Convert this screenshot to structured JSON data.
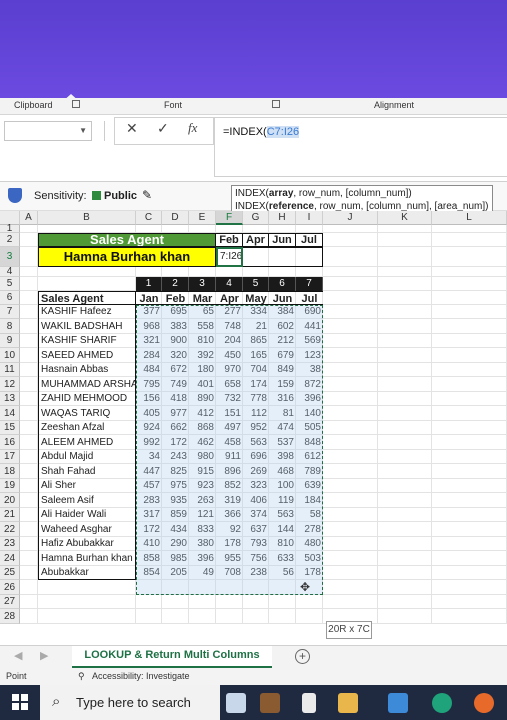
{
  "ribbon": {
    "clipboard": "Clipboard",
    "font": "Font",
    "alignment": "Alignment"
  },
  "formula_bar": {
    "name_box": "",
    "cancel": "✕",
    "enter": "✓",
    "fx": "fx",
    "formula_prefix": "=INDEX(",
    "formula_ref": "C7:I26"
  },
  "sensitivity": {
    "label": "Sensitivity:",
    "value": "Public",
    "badge_color": "#2e8b3d"
  },
  "tooltip": {
    "line1_pre": "INDEX(",
    "line1_bold": "array",
    "line1_post": ", row_num, [column_num])",
    "line2_pre": "INDEX(",
    "line2_bold": "reference",
    "line2_post": ", row_num, [column_num], [area_num])"
  },
  "columns": [
    "A",
    "B",
    "C",
    "D",
    "E",
    "F",
    "G",
    "H",
    "I",
    "J",
    "K",
    "L"
  ],
  "rows": [
    "1",
    "2",
    "3",
    "4",
    "5",
    "6",
    "7",
    "8",
    "9",
    "10",
    "11",
    "12",
    "13",
    "14",
    "15",
    "16",
    "17",
    "18",
    "19",
    "20",
    "21",
    "22",
    "23",
    "24",
    "25",
    "26",
    "27",
    "28"
  ],
  "top_table": {
    "header": "Sales Agent",
    "months": [
      "Feb",
      "Apr",
      "Jun",
      "Jul"
    ],
    "agent": "Hamna Burhan khan",
    "cell_f3": "7:I26"
  },
  "index_row": [
    "1",
    "2",
    "3",
    "4",
    "5",
    "6",
    "7"
  ],
  "main_table": {
    "header": "Sales Agent",
    "months": [
      "Jan",
      "Feb",
      "Mar",
      "Apr",
      "May",
      "Jun",
      "Jul"
    ],
    "rows": [
      {
        "agent": "KASHIF Hafeez",
        "v": [
          "377",
          "695",
          "65",
          "277",
          "334",
          "384",
          "690"
        ]
      },
      {
        "agent": "WAKIL BADSHAH",
        "v": [
          "968",
          "383",
          "558",
          "748",
          "21",
          "602",
          "441"
        ]
      },
      {
        "agent": "KASHIF SHARIF",
        "v": [
          "321",
          "900",
          "810",
          "204",
          "865",
          "212",
          "569"
        ]
      },
      {
        "agent": "SAEED AHMED",
        "v": [
          "284",
          "320",
          "392",
          "450",
          "165",
          "679",
          "123"
        ]
      },
      {
        "agent": "Hasnain Abbas",
        "v": [
          "484",
          "672",
          "180",
          "970",
          "704",
          "849",
          "38"
        ]
      },
      {
        "agent": "MUHAMMAD ARSHAD",
        "v": [
          "795",
          "749",
          "401",
          "658",
          "174",
          "159",
          "872"
        ]
      },
      {
        "agent": "ZAHID MEHMOOD",
        "v": [
          "156",
          "418",
          "890",
          "732",
          "778",
          "316",
          "396"
        ]
      },
      {
        "agent": "WAQAS TARIQ",
        "v": [
          "405",
          "977",
          "412",
          "151",
          "112",
          "81",
          "140"
        ]
      },
      {
        "agent": "Zeeshan Afzal",
        "v": [
          "924",
          "662",
          "868",
          "497",
          "952",
          "474",
          "505"
        ]
      },
      {
        "agent": "ALEEM AHMED",
        "v": [
          "992",
          "172",
          "462",
          "458",
          "563",
          "537",
          "848"
        ]
      },
      {
        "agent": "Abdul Majid",
        "v": [
          "34",
          "243",
          "980",
          "911",
          "696",
          "398",
          "612"
        ]
      },
      {
        "agent": "Shah Fahad",
        "v": [
          "447",
          "825",
          "915",
          "896",
          "269",
          "468",
          "789"
        ]
      },
      {
        "agent": "Ali Sher",
        "v": [
          "457",
          "975",
          "923",
          "852",
          "323",
          "100",
          "639"
        ]
      },
      {
        "agent": "Saleem Asif",
        "v": [
          "283",
          "935",
          "263",
          "319",
          "406",
          "119",
          "184"
        ]
      },
      {
        "agent": "Ali Haider Wali",
        "v": [
          "317",
          "859",
          "121",
          "366",
          "374",
          "563",
          "58"
        ]
      },
      {
        "agent": "Waheed Asghar",
        "v": [
          "172",
          "434",
          "833",
          "92",
          "637",
          "144",
          "278"
        ]
      },
      {
        "agent": "Hafiz Abubakkar",
        "v": [
          "410",
          "290",
          "380",
          "178",
          "793",
          "810",
          "480"
        ]
      },
      {
        "agent": "Hamna Burhan khan",
        "v": [
          "858",
          "985",
          "396",
          "955",
          "756",
          "633",
          "503"
        ]
      },
      {
        "agent": "Abubakkar",
        "v": [
          "854",
          "205",
          "49",
          "708",
          "238",
          "56",
          "178"
        ]
      }
    ]
  },
  "size_tip": "20R x 7C",
  "sheet_tab": "LOOKUP & Return Multi Columns",
  "status": {
    "mode": "Point",
    "accessibility": "Accessibility: Investigate"
  },
  "taskbar": {
    "search": "Type here to search"
  }
}
